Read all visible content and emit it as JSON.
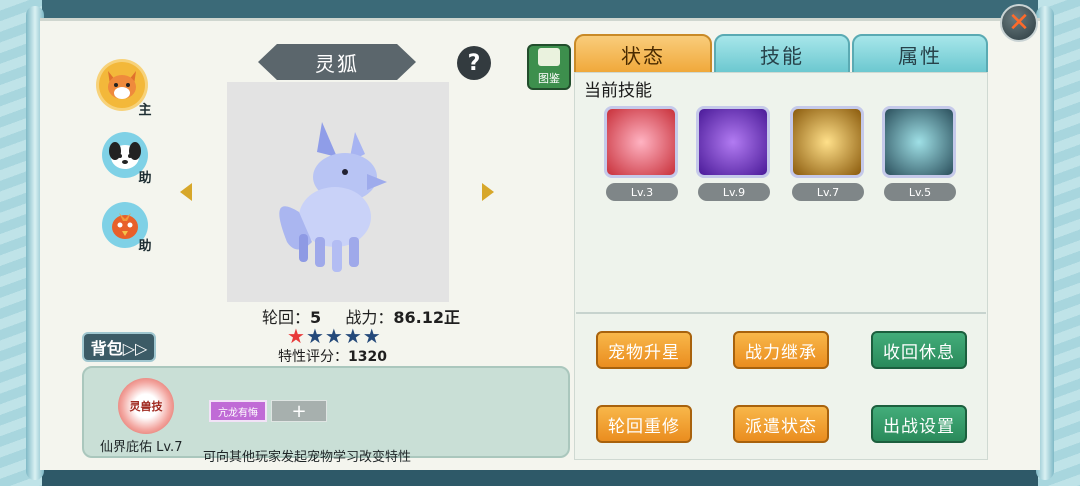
{
  "pet": {
    "name": "灵狐",
    "reincarnation_label": "轮回：",
    "reincarnation_value": "5",
    "power_label": "战力：",
    "power_value": "86.12正",
    "stars_total": 5,
    "stars_red": 1,
    "trait_score_label": "特性评分：",
    "trait_score_value": "1320"
  },
  "roster": [
    {
      "icon": "fox-portrait-icon",
      "tag": "主"
    },
    {
      "icon": "dog-portrait-icon",
      "tag": "助"
    },
    {
      "icon": "bird-portrait-icon",
      "tag": "助"
    }
  ],
  "atlas_label": "图鉴",
  "bag_label": "背包▷▷",
  "trait": {
    "icon_text": "灵兽技",
    "name": "仙界庇佑 Lv.7",
    "chip": "亢龙有悔",
    "add": "+",
    "hint": "可向其他玩家发起宠物学习改变特性"
  },
  "tabs": [
    "状态",
    "技能",
    "属性"
  ],
  "skills_title": "当前技能",
  "skills": [
    {
      "level": "Lv.3",
      "color": "#c8303a"
    },
    {
      "level": "Lv.9",
      "color": "#6a2bd0"
    },
    {
      "level": "Lv.7",
      "color": "#d79a16"
    },
    {
      "level": "Lv.5",
      "color": "#2b6c7a"
    }
  ],
  "actions": [
    {
      "label": "宠物升星",
      "style": "orange"
    },
    {
      "label": "战力继承",
      "style": "orange"
    },
    {
      "label": "收回休息",
      "style": "green"
    },
    {
      "label": "轮回重修",
      "style": "orange"
    },
    {
      "label": "派遣状态",
      "style": "orange"
    },
    {
      "label": "出战设置",
      "style": "green"
    }
  ],
  "close_symbol": "✕",
  "help_symbol": "?"
}
